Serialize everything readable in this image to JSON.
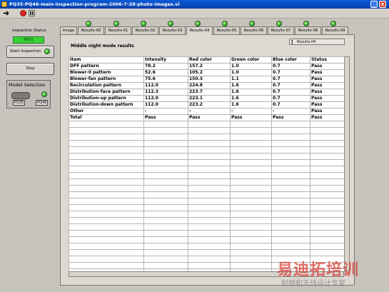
{
  "window": {
    "title": "PQ35-PQ46-main-inspection-program-2006-7-28-photo-images.vi",
    "minimize": "_",
    "close": "x"
  },
  "left_panel": {
    "status_label": "Inspection Status",
    "status_value": "PASS",
    "start_button": "Start Inspection",
    "stop_button": "Stop",
    "model_selection_title": "Model Selection",
    "model_options": [
      "PQ35",
      "PQ46"
    ]
  },
  "tabs": [
    {
      "label": "Image",
      "led": false,
      "active": false
    },
    {
      "label": "Results-00",
      "led": true,
      "active": false
    },
    {
      "label": "Results-01",
      "led": true,
      "active": false
    },
    {
      "label": "Results-02",
      "led": true,
      "active": false
    },
    {
      "label": "Results-03",
      "led": true,
      "active": false
    },
    {
      "label": "Results-04",
      "led": true,
      "active": true
    },
    {
      "label": "Results-05",
      "led": true,
      "active": false
    },
    {
      "label": "Results-06",
      "led": true,
      "active": false
    },
    {
      "label": "Results-07",
      "led": true,
      "active": false
    },
    {
      "label": "Results-08",
      "led": true,
      "active": false
    },
    {
      "label": "Results-09",
      "led": true,
      "active": false
    }
  ],
  "results": {
    "title": "Middle night mode results",
    "selector_value": "Results-04",
    "columns": [
      "Item",
      "Intensity",
      "Red color",
      "Green color",
      "Blue color",
      "Status"
    ],
    "rows": [
      [
        "DFF pattern",
        "78.2",
        "157.2",
        "1.0",
        "0.7",
        "Pass"
      ],
      [
        "Blower-0 pattern",
        "52.6",
        "105.2",
        "1.0",
        "0.7",
        "Pass"
      ],
      [
        "Blower-fan pattern",
        "75.6",
        "150.3",
        "1.1",
        "0.7",
        "Pass"
      ],
      [
        "Recirculation pattern",
        "112.0",
        "224.8",
        "1.6",
        "0.7",
        "Pass"
      ],
      [
        "Distribution-face pattern",
        "112.3",
        "223.7",
        "1.6",
        "0.7",
        "Pass"
      ],
      [
        "Distribution-up pattern",
        "112.0",
        "223.1",
        "1.6",
        "0.7",
        "Pass"
      ],
      [
        "Distribution-down pattern",
        "112.0",
        "223.2",
        "1.6",
        "0.7",
        "Pass"
      ],
      [
        "Other",
        "-",
        "-",
        "-",
        "-",
        "Pass"
      ],
      [
        "Total",
        "Pass",
        "Pass",
        "Pass",
        "Pass",
        "Pass"
      ]
    ],
    "empty_rows": 24
  },
  "watermark": {
    "main": "易迪拓培训",
    "sub": "射频和天线设计专家"
  },
  "colors": {
    "pass_green": "#36d236",
    "titlebar_blue": "#0a5ad8",
    "watermark_red": "#d9403a"
  }
}
